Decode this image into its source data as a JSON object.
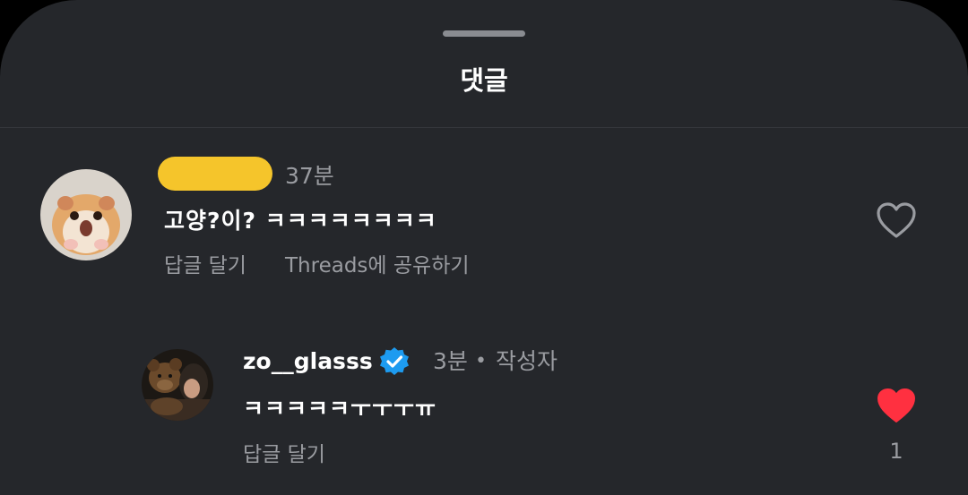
{
  "sheet": {
    "title": "댓글"
  },
  "comments": [
    {
      "username_redacted": true,
      "time": "37분",
      "text": "고양?이? ㅋㅋㅋㅋㅋㅋㅋㅋ",
      "actions": {
        "reply": "답글 달기",
        "share": "Threads에 공유하기"
      },
      "liked": false,
      "avatar": "hamster-avatar"
    }
  ],
  "reply": {
    "username": "zo__glasss",
    "verified": true,
    "time": "3분",
    "separator": "•",
    "author_label": "작성자",
    "text": "ㅋㅋㅋㅋㅋㅜㅜㅜㅠ",
    "actions": {
      "reply": "답글 달기"
    },
    "liked": true,
    "like_count": "1",
    "avatar": "profile-photo-avatar"
  },
  "colors": {
    "background": "#25272b",
    "text_primary": "#ffffff",
    "text_secondary": "#9a9ca1",
    "like_red": "#ff3040",
    "verified_blue": "#1d9bf0",
    "redaction": "#f5c52b"
  }
}
